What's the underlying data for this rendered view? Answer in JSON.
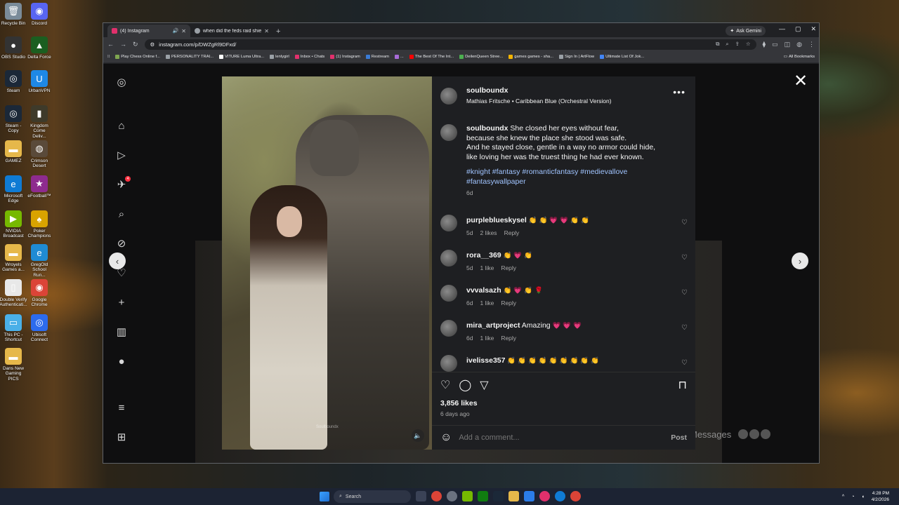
{
  "desktop": {
    "icons": [
      {
        "label": "Recycle Bin",
        "color": "#7a8b99",
        "glyph": "🗑"
      },
      {
        "label": "Discord",
        "color": "#5865f2",
        "glyph": "◉"
      },
      {
        "label": "OBS Studio",
        "color": "#333333",
        "glyph": "●"
      },
      {
        "label": "Delta Force",
        "color": "#1b5e20",
        "glyph": "▲"
      },
      {
        "label": "Steam",
        "color": "#1b2838",
        "glyph": "◎"
      },
      {
        "label": "UrbanVPN",
        "color": "#1e88e5",
        "glyph": "U"
      },
      {
        "label": "Steam - Copy",
        "color": "#1b2838",
        "glyph": "◎"
      },
      {
        "label": "Kingdom Come Deliv...",
        "color": "#3e3a2a",
        "glyph": "▮"
      },
      {
        "label": "GAMEZ",
        "color": "#e6b84a",
        "glyph": "▬"
      },
      {
        "label": "Crimson Desert",
        "color": "#5a4a3a",
        "glyph": "◍"
      },
      {
        "label": "Microsoft Edge",
        "color": "#0f7bd4",
        "glyph": "e"
      },
      {
        "label": "eFootball™",
        "color": "#8e2b8e",
        "glyph": "★"
      },
      {
        "label": "NVIDIA Broadcast",
        "color": "#76b900",
        "glyph": "▶"
      },
      {
        "label": "Poker Champions",
        "color": "#d9a300",
        "glyph": "♠"
      },
      {
        "label": "Wroyels Games a...",
        "color": "#e6b84a",
        "glyph": "▬"
      },
      {
        "label": "GregOld School Run...",
        "color": "#1f8bd3",
        "glyph": "e"
      },
      {
        "label": "Double Verify Authenticati...",
        "color": "#e8e8e8",
        "glyph": "▯"
      },
      {
        "label": "Google Chrome",
        "color": "#db4437",
        "glyph": "◉"
      },
      {
        "label": "This PC - Shortcut",
        "color": "#4ab0e8",
        "glyph": "▭"
      },
      {
        "label": "Ubisoft Connect",
        "color": "#2c6bed",
        "glyph": "◎"
      },
      {
        "label": "Dans New Gaming PICS",
        "color": "#e6b84a",
        "glyph": "▬"
      }
    ]
  },
  "browser": {
    "tabs": [
      {
        "title": "(4) Instagram",
        "active": true,
        "color": "#e1306c"
      },
      {
        "title": "when did the feds raid shiesty",
        "active": false,
        "color": "#9aa0a6"
      }
    ],
    "ask_gemini": "Ask Gemini",
    "url": "instagram.com/p/DWZgRl9DFxd/",
    "bookmarks": [
      {
        "label": "Play Chess Online f...",
        "color": "#7fa650"
      },
      {
        "label": "PERSONALITY TRAI...",
        "color": "#9aa0a6"
      },
      {
        "label": "VITURE Luma Ultra...",
        "color": "#ffffff"
      },
      {
        "label": "lenlygirl",
        "color": "#9aa0a6"
      },
      {
        "label": "Inbox • Chats",
        "color": "#e1306c"
      },
      {
        "label": "(1) Instagram",
        "color": "#e1306c"
      },
      {
        "label": "Restream",
        "color": "#3a7bd5"
      },
      {
        "label": "...",
        "color": "#a86bd8"
      },
      {
        "label": "The Best Of The Int...",
        "color": "#ff0000"
      },
      {
        "label": "DeilenQueen Stree...",
        "color": "#4caf50"
      },
      {
        "label": "games games - sha...",
        "color": "#f4b400"
      },
      {
        "label": "Sign In | ArtFlow",
        "color": "#9aa0a6"
      },
      {
        "label": "Ultimate List Of Jok...",
        "color": "#4285f4"
      }
    ],
    "all_bookmarks": "All Bookmarks"
  },
  "instagram": {
    "notification_count": "4",
    "messages_label": "Messages",
    "post": {
      "author": "soulboundx",
      "audio": "Mathias Fritsche • Caribbean Blue (Orchestral Version)",
      "caption_lines": [
        "She closed her eyes without fear,",
        "because she knew the place she stood was safe.",
        "And he stayed close, gentle in a way no armor could hide,",
        "like loving her was the truest thing he had ever known."
      ],
      "hashtags_line1": "#knight #fantasy #romanticfantasy #medievallove",
      "hashtags_line2": "#fantasywallpaper",
      "caption_age": "6d",
      "watermark": "Soulboundx",
      "likes": "3,856 likes",
      "posted": "6 days ago",
      "comment_placeholder": "Add a comment...",
      "post_button": "Post"
    },
    "comments": [
      {
        "user": "purpleblueskysel",
        "text": "",
        "emoji": "👏 👏 💗 💗 👏 👏",
        "age": "5d",
        "likes": "2 likes",
        "reply": "Reply"
      },
      {
        "user": "rora__369",
        "text": "",
        "emoji": "👏 💗 👏",
        "age": "5d",
        "likes": "1 like",
        "reply": "Reply"
      },
      {
        "user": "vvvalsazh",
        "text": "",
        "emoji": "👏 💗 👏 🌹",
        "age": "6d",
        "likes": "1 like",
        "reply": "Reply"
      },
      {
        "user": "mira_artproject",
        "text": "Amazing",
        "emoji": "💗 💗 💗",
        "age": "6d",
        "likes": "1 like",
        "reply": "Reply"
      },
      {
        "user": "ivelisse357",
        "text": "",
        "emoji": "👏 👏 👏 👏 👏 👏 👏 👏 👏",
        "age": "",
        "likes": "",
        "reply": ""
      }
    ]
  },
  "taskbar": {
    "search_placeholder": "Search",
    "time": "4:28 PM",
    "date": "4/2/2026"
  }
}
